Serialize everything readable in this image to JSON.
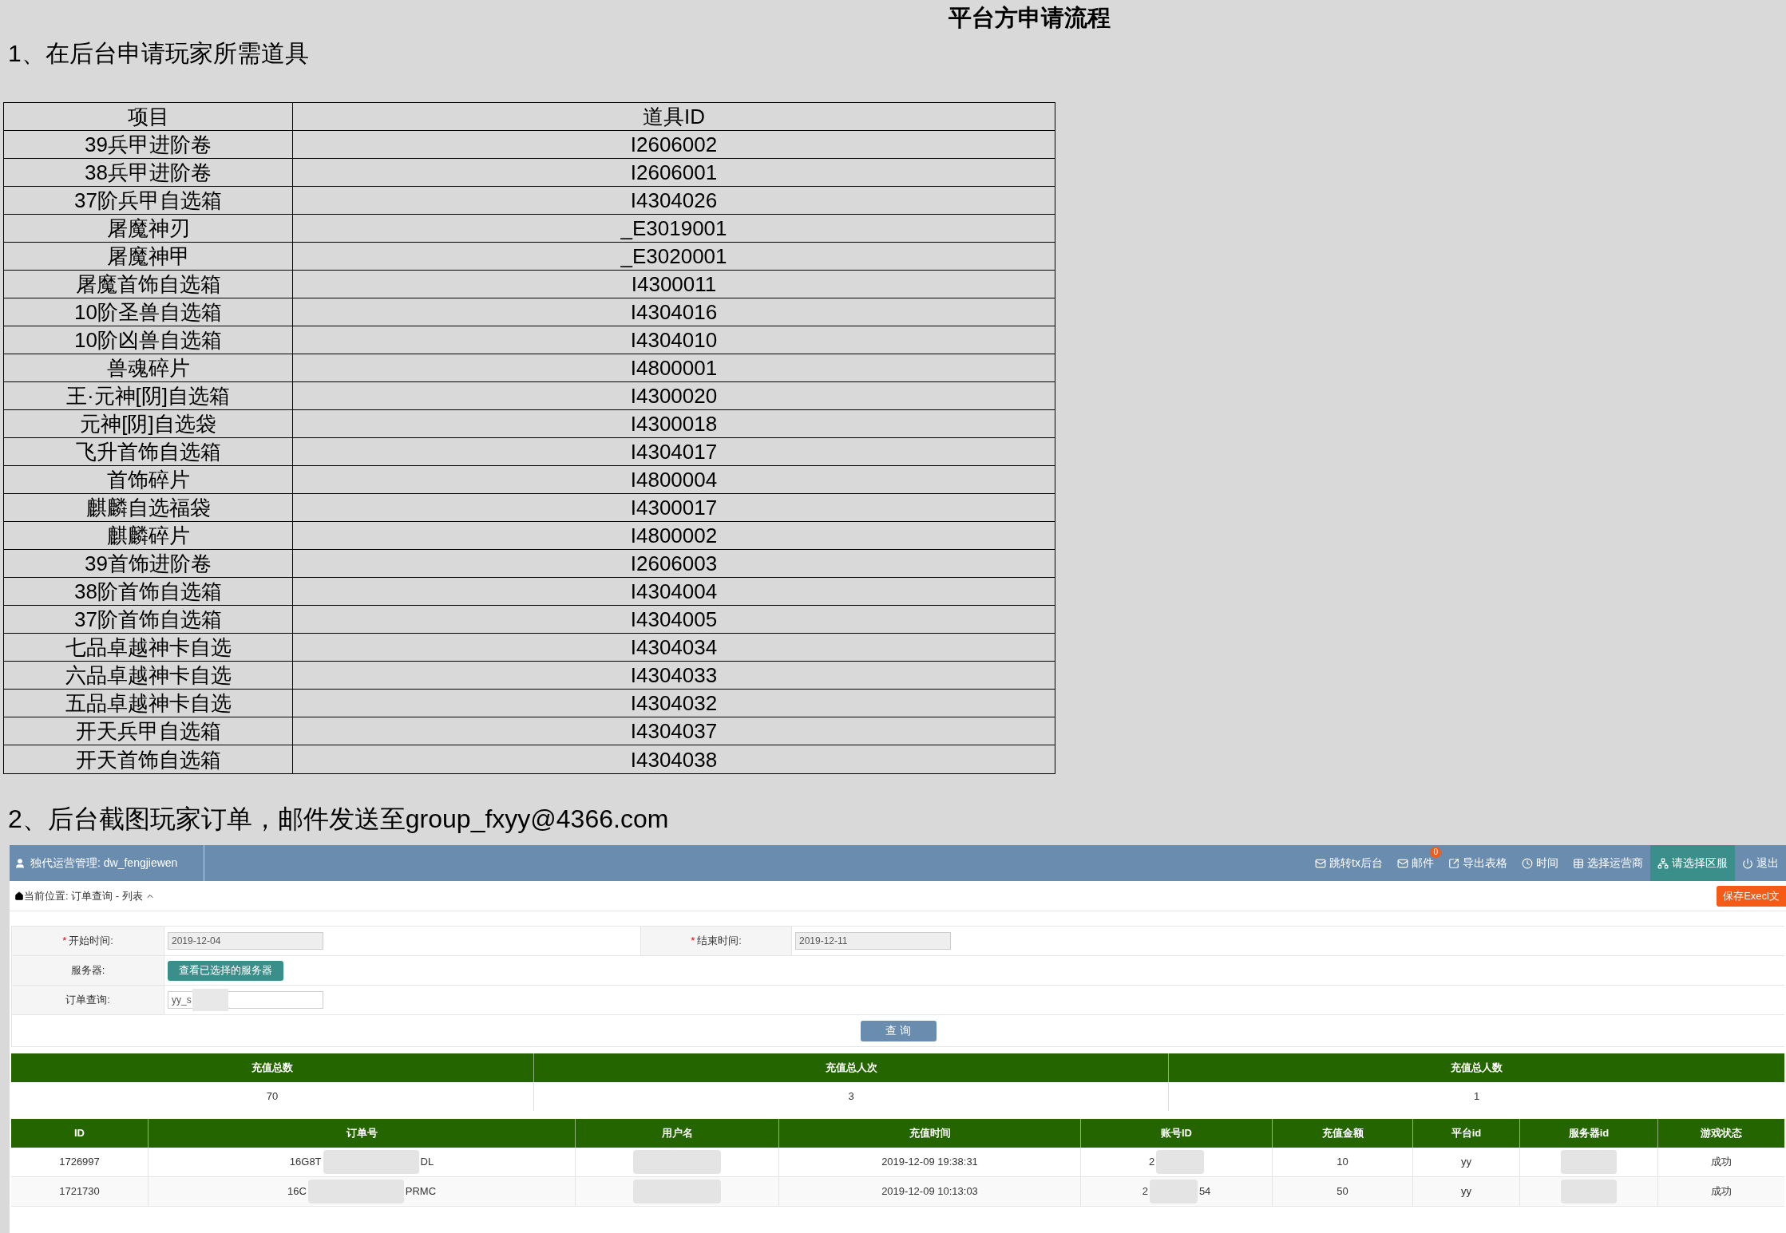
{
  "title": "平台方申请流程",
  "section1": {
    "heading": "1、在后台申请玩家所需道具",
    "table": {
      "columns": [
        "项目",
        "道具ID"
      ],
      "rows": [
        [
          "39兵甲进阶卷",
          "I2606002"
        ],
        [
          "38兵甲进阶卷",
          "I2606001"
        ],
        [
          "37阶兵甲自选箱",
          "I4304026"
        ],
        [
          "屠魔神刃",
          "_E3019001"
        ],
        [
          "屠魔神甲",
          "_E3020001"
        ],
        [
          "屠魔首饰自选箱",
          "I4300011"
        ],
        [
          "10阶圣兽自选箱",
          "I4304016"
        ],
        [
          "10阶凶兽自选箱",
          "I4304010"
        ],
        [
          "兽魂碎片",
          "I4800001"
        ],
        [
          "王·元神[阴]自选箱",
          "I4300020"
        ],
        [
          "元神[阴]自选袋",
          "I4300018"
        ],
        [
          "飞升首饰自选箱",
          "I4304017"
        ],
        [
          "首饰碎片",
          "I4800004"
        ],
        [
          "麒麟自选福袋",
          "I4300017"
        ],
        [
          "麒麟碎片",
          "I4800002"
        ],
        [
          "39首饰进阶卷",
          "I2606003"
        ],
        [
          "38阶首饰自选箱",
          "I4304004"
        ],
        [
          "37阶首饰自选箱",
          "I4304005"
        ],
        [
          "七品卓越神卡自选",
          "I4304034"
        ],
        [
          "六品卓越神卡自选",
          "I4304033"
        ],
        [
          "五品卓越神卡自选",
          "I4304032"
        ],
        [
          "开天兵甲自选箱",
          "I4304037"
        ],
        [
          "开天首饰自选箱",
          "I4304038"
        ]
      ]
    }
  },
  "section2": {
    "heading": "2、后台截图玩家订单，邮件发送至group_fxyy@4366.com"
  },
  "screenshot": {
    "user": "独代运营管理: dw_fengjiewen",
    "nav": [
      {
        "kind": "mail",
        "label": "跳转tx后台",
        "selected": false
      },
      {
        "kind": "mail",
        "label": "邮件",
        "badge": "0",
        "selected": false
      },
      {
        "kind": "share",
        "label": "导出表格",
        "selected": false
      },
      {
        "kind": "clock",
        "label": "时间",
        "selected": false
      },
      {
        "kind": "table",
        "label": "选择运营商",
        "selected": false
      },
      {
        "kind": "sitemap",
        "label": "请选择区服",
        "selected": true
      },
      {
        "kind": "power",
        "label": "退出",
        "selected": false
      }
    ],
    "breadcrumb": "当前位置: 订单查询 - 列表",
    "save_button": "保存Execl文",
    "form": {
      "start_mark": "*",
      "start_label": "开始时间:",
      "start_value": "2019-12-04",
      "end_mark": "*",
      "end_label": "结束时间:",
      "end_value": "2019-12-11",
      "server_label": "服务器:",
      "server_button": "查看已选择的服务器",
      "order_label": "订单查询:",
      "order_value": "yy_s"
    },
    "query_button": "查 询",
    "summary": {
      "columns": [
        "充值总数",
        "充值总人次",
        "充值总人数"
      ],
      "values": [
        "70",
        "3",
        "1"
      ]
    },
    "orders": {
      "columns": [
        "ID",
        "订单号",
        "用户名",
        "充值时间",
        "账号ID",
        "充值金额",
        "平台id",
        "服务器id",
        "游戏状态"
      ],
      "rows": [
        {
          "id": "1726997",
          "order": [
            "16G8T",
            "DL"
          ],
          "time": "2019-12-09 19:38:31",
          "account": [
            "2"
          ],
          "amount": "10",
          "platform": "yy",
          "status": "成功"
        },
        {
          "id": "1721730",
          "order": [
            "16C",
            "PRMC"
          ],
          "time": "2019-12-09 10:13:03",
          "account": [
            "2",
            "54"
          ],
          "amount": "50",
          "platform": "yy",
          "status": "成功"
        }
      ]
    }
  }
}
